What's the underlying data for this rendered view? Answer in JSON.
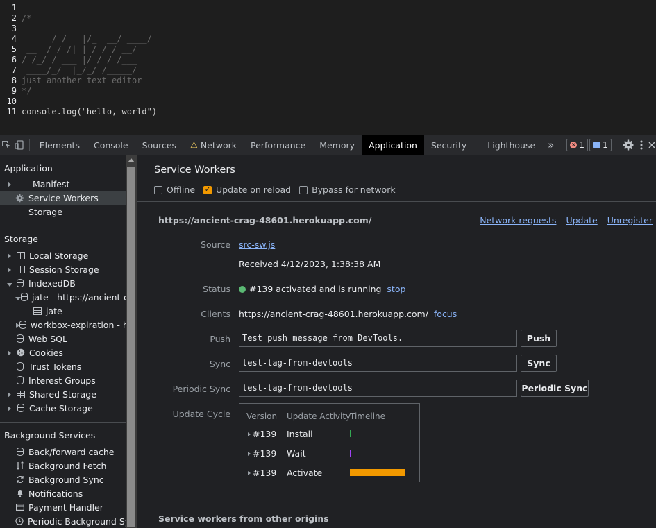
{
  "editor": {
    "lines": [
      {
        "n": "1",
        "text": "",
        "cls": ""
      },
      {
        "n": "2",
        "text": "/*",
        "cls": "cmt"
      },
      {
        "n": "3",
        "text": "       _____ ___________",
        "cls": "cmt"
      },
      {
        "n": "4",
        "text": "      / /   |/_  __/ ____/",
        "cls": "cmt"
      },
      {
        "n": "5",
        "text": " __  / / /| | / / / __/",
        "cls": "cmt"
      },
      {
        "n": "6",
        "text": "/ /_/ / ___ |/ / / /___",
        "cls": "cmt"
      },
      {
        "n": "7",
        "text": " ____/_/  |_/_/ /_____/",
        "cls": "cmt"
      },
      {
        "n": "8",
        "text": "just another text editor",
        "cls": "cmt"
      },
      {
        "n": "9",
        "text": "*/",
        "cls": "cmt"
      },
      {
        "n": "10",
        "text": "",
        "cls": ""
      },
      {
        "n": "11",
        "text": "console.log(\"hello, world\")",
        "cls": "str"
      }
    ]
  },
  "tabs": {
    "items": [
      "Elements",
      "Console",
      "Sources",
      "Network",
      "Performance",
      "Memory",
      "Application",
      "Security",
      "Lighthouse"
    ],
    "more": "»",
    "error_count": "1",
    "message_count": "1"
  },
  "sidebar": {
    "application_heading": "Application",
    "application_items": [
      "Manifest",
      "Service Workers",
      "Storage"
    ],
    "storage_heading": "Storage",
    "storage_items": [
      "Local Storage",
      "Session Storage",
      "IndexedDB",
      "jate - https://ancient-cra",
      "jate",
      "workbox-expiration - htt",
      "Web SQL",
      "Cookies",
      "Trust Tokens",
      "Interest Groups",
      "Shared Storage",
      "Cache Storage"
    ],
    "bg_heading": "Background Services",
    "bg_items": [
      "Back/forward cache",
      "Background Fetch",
      "Background Sync",
      "Notifications",
      "Payment Handler",
      "Periodic Background Sync"
    ]
  },
  "main": {
    "title": "Service Workers",
    "options": [
      "Offline",
      "Update on reload",
      "Bypass for network"
    ],
    "origin": "https://ancient-crag-48601.herokuapp.com/",
    "origin_links": [
      "Network requests",
      "Update",
      "Unregister"
    ],
    "source_label": "Source",
    "source_link": "src-sw.js",
    "received": "Received 4/12/2023, 1:38:38 AM",
    "status_label": "Status",
    "status_text": "#139 activated and is running",
    "status_link": "stop",
    "clients_label": "Clients",
    "clients_text": "https://ancient-crag-48601.herokuapp.com/",
    "clients_link": "focus",
    "push_label": "Push",
    "push_value": "Test push message from DevTools.",
    "push_button": "Push",
    "sync_label": "Sync",
    "sync_value": "test-tag-from-devtools",
    "sync_button": "Sync",
    "periodic_label": "Periodic Sync",
    "periodic_value": "test-tag-from-devtools",
    "periodic_button": "Periodic Sync",
    "cycle_label": "Update Cycle",
    "cycle_headers": [
      "Version",
      "Update Activity",
      "Timeline"
    ],
    "cycle_rows": [
      {
        "version": "#139",
        "activity": "Install",
        "color": "#34a853"
      },
      {
        "version": "#139",
        "activity": "Wait",
        "color": "#a142f4"
      },
      {
        "version": "#139",
        "activity": "Activate",
        "color": "#f29900"
      }
    ],
    "other_origins": "Service workers from other origins"
  }
}
